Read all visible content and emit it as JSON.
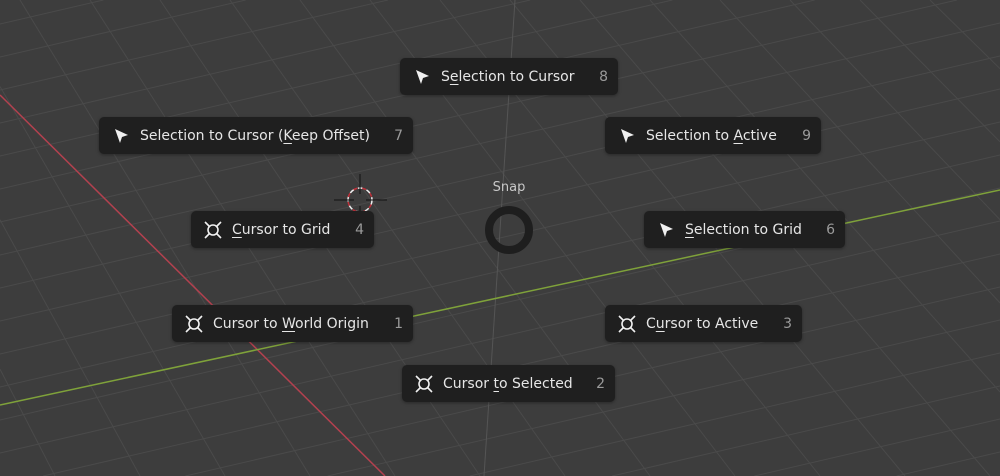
{
  "pie_menu": {
    "title": "Snap",
    "items": [
      {
        "pre": "S",
        "key": "e",
        "post": "lection to Cursor",
        "shortcut": "8",
        "icon": "arrow-cursor-icon"
      },
      {
        "pre": "Selection to Cursor (",
        "key": "K",
        "post": "eep Offset)",
        "shortcut": "7",
        "icon": "arrow-cursor-icon"
      },
      {
        "pre": "Selection to ",
        "key": "A",
        "post": "ctive",
        "shortcut": "9",
        "icon": "arrow-cursor-icon"
      },
      {
        "pre": "",
        "key": "C",
        "post": "ursor to Grid",
        "shortcut": "4",
        "icon": "3d-cursor-icon"
      },
      {
        "pre": "",
        "key": "S",
        "post": "election to Grid",
        "shortcut": "6",
        "icon": "arrow-cursor-icon"
      },
      {
        "pre": "Cursor to ",
        "key": "W",
        "post": "orld Origin",
        "shortcut": "1",
        "icon": "3d-cursor-icon"
      },
      {
        "pre": "C",
        "key": "u",
        "post": "rsor to Active",
        "shortcut": "3",
        "icon": "3d-cursor-icon"
      },
      {
        "pre": "Cursor ",
        "key": "t",
        "post": "o Selected",
        "shortcut": "2",
        "icon": "3d-cursor-icon"
      }
    ]
  },
  "colors": {
    "background": "#3d3d3d",
    "x_axis": "#b3414f",
    "y_axis": "#7fa23a",
    "item_bg": "#1f1f1f"
  }
}
